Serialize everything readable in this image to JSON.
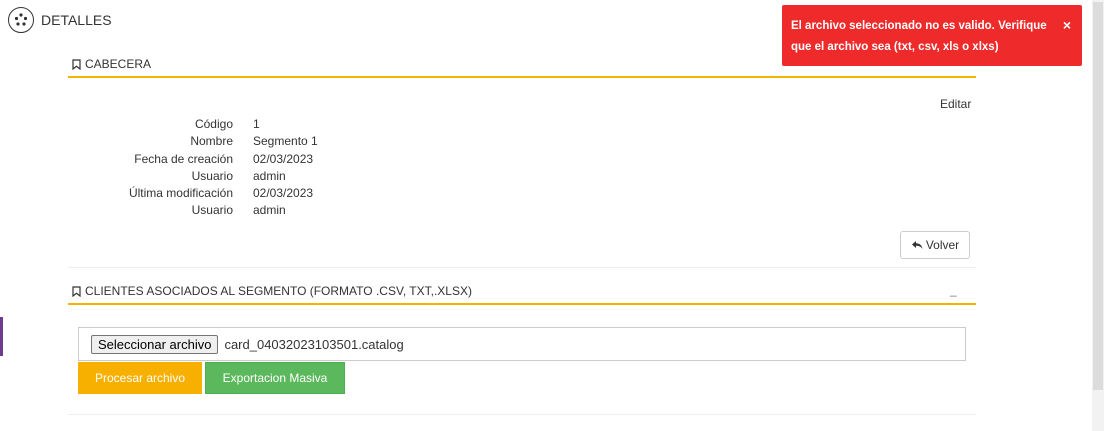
{
  "header": {
    "title": "DETALLES",
    "logo_icon": "segment-logo-icon"
  },
  "cabecera": {
    "title": "CABECERA",
    "edit_label": "Editar",
    "fields": [
      {
        "label": "Código",
        "value": "1"
      },
      {
        "label": "Nombre",
        "value": "Segmento 1"
      },
      {
        "label": "Fecha de creación",
        "value": "02/03/2023"
      },
      {
        "label": "Usuario",
        "value": "admin"
      },
      {
        "label": "Última modificación",
        "value": "02/03/2023"
      },
      {
        "label": "Usuario",
        "value": "admin"
      }
    ],
    "back_label": "Volver"
  },
  "clientes": {
    "title": "CLIENTES ASOCIADOS AL SEGMENTO (FORMATO .CSV, TXT,.XLSX)",
    "collapse_label": "_",
    "file_button_label": "Seleccionar archivo",
    "file_name": "card_04032023103501.catalog",
    "process_label": "Procesar archivo",
    "export_label": "Exportacion Masiva"
  },
  "toast": {
    "message": "El archivo seleccionado no es valido. Verifique que el archivo sea (txt, csv, xls o xlxs)",
    "close_label": "×"
  },
  "colors": {
    "accent_gold": "#f4b400",
    "process_button": "#f7b000",
    "export_button": "#5cb85c",
    "toast_error": "#ee2a2a",
    "left_accent": "#6f3b8f"
  }
}
